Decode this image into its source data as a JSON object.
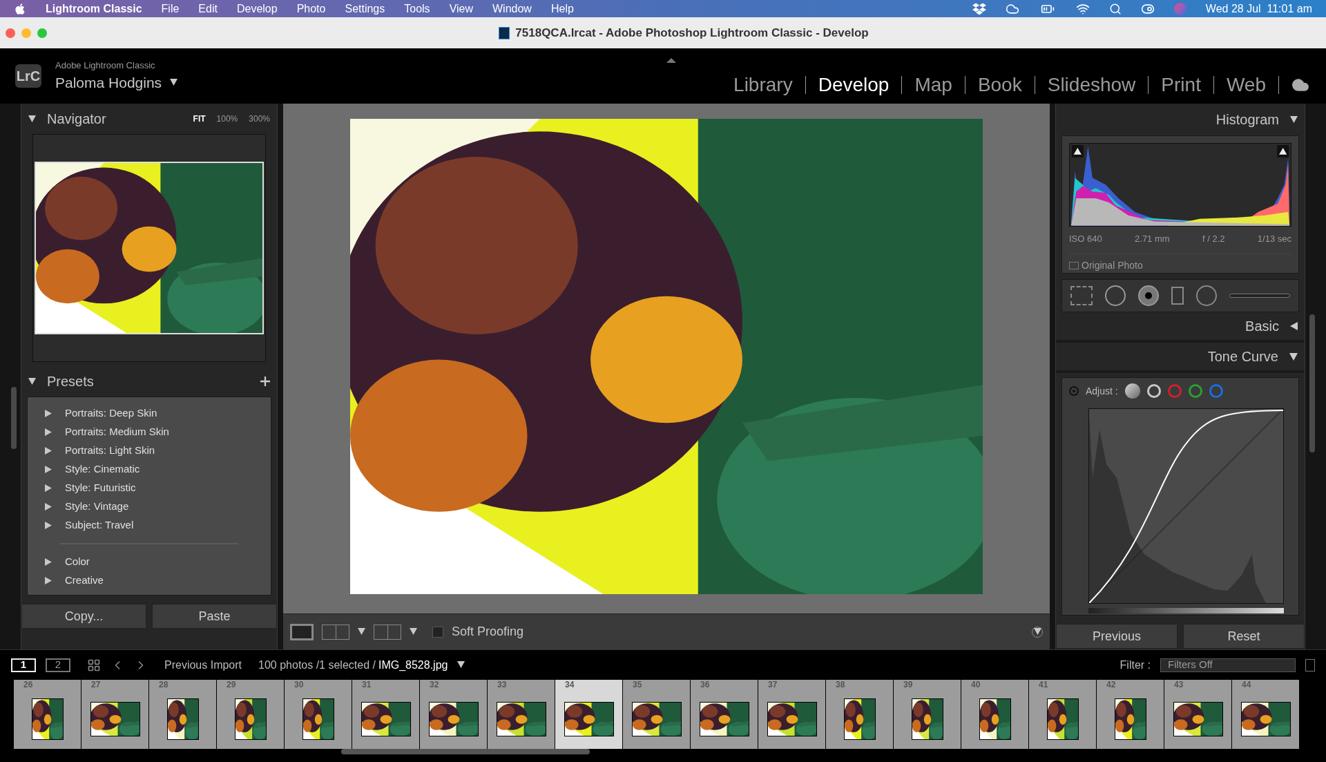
{
  "menubar": {
    "app": "Lightroom Classic",
    "menus": [
      "File",
      "Edit",
      "Develop",
      "Photo",
      "Settings",
      "Tools",
      "View",
      "Window",
      "Help"
    ],
    "clock": "Wed 28 Jul  11:01 am"
  },
  "window": {
    "title": "7518QCA.lrcat - Adobe Photoshop Lightroom Classic - Develop"
  },
  "identity": {
    "logo": "LrC",
    "product": "Adobe Lightroom Classic",
    "user": "Paloma Hodgins"
  },
  "modules": [
    {
      "label": "Library",
      "selected": false
    },
    {
      "label": "Develop",
      "selected": true
    },
    {
      "label": "Map",
      "selected": false
    },
    {
      "label": "Book",
      "selected": false
    },
    {
      "label": "Slideshow",
      "selected": false
    },
    {
      "label": "Print",
      "selected": false
    },
    {
      "label": "Web",
      "selected": false
    }
  ],
  "navigator": {
    "title": "Navigator",
    "zoom": [
      {
        "label": "FIT",
        "selected": true
      },
      {
        "label": "100%",
        "selected": false
      },
      {
        "label": "300%",
        "selected": false
      }
    ]
  },
  "presets": {
    "title": "Presets",
    "groups": [
      "Portraits: Deep Skin",
      "Portraits: Medium Skin",
      "Portraits: Light Skin",
      "Style: Cinematic",
      "Style: Futuristic",
      "Style: Vintage",
      "Subject: Travel"
    ],
    "more_groups": [
      "Color",
      "Creative"
    ]
  },
  "left_buttons": [
    "Copy...",
    "Paste"
  ],
  "toolbar": {
    "soft_proofing": {
      "label": "Soft Proofing",
      "checked": false
    }
  },
  "histogram": {
    "title": "Histogram",
    "exif": [
      "ISO 640",
      "2.71 mm",
      "f / 2.2",
      "1/13 sec"
    ],
    "original_photo": {
      "label": "Original Photo",
      "checked": false
    }
  },
  "panels": [
    {
      "title": "Basic",
      "expanded": false
    },
    {
      "title": "Tone Curve",
      "expanded": true
    }
  ],
  "tone_curve": {
    "adjust_label": "Adjust :",
    "channels": [
      {
        "color": "#c8c8c8"
      },
      {
        "color": "#d0202a"
      },
      {
        "color": "#2aa030"
      },
      {
        "color": "#1a6ee0"
      }
    ]
  },
  "right_buttons": [
    "Previous",
    "Reset"
  ],
  "filmstrip_bar": {
    "pages": [
      {
        "label": "1",
        "selected": true
      },
      {
        "label": "2",
        "selected": false
      }
    ],
    "source": "Previous Import",
    "count": "100 photos /1 selected /",
    "file": "IMG_8528.jpg",
    "filter_label": "Filter :",
    "filter_value": "Filters Off"
  },
  "filmstrip": [
    {
      "number": "26",
      "selected": false
    },
    {
      "number": "27",
      "selected": false
    },
    {
      "number": "28",
      "selected": false
    },
    {
      "number": "29",
      "selected": false
    },
    {
      "number": "30",
      "selected": false
    },
    {
      "number": "31",
      "selected": false
    },
    {
      "number": "32",
      "selected": false
    },
    {
      "number": "33",
      "selected": false
    },
    {
      "number": "34",
      "selected": true
    },
    {
      "number": "35",
      "selected": false
    },
    {
      "number": "36",
      "selected": false
    },
    {
      "number": "37",
      "selected": false
    },
    {
      "number": "38",
      "selected": false
    },
    {
      "number": "39",
      "selected": false
    },
    {
      "number": "40",
      "selected": false
    },
    {
      "number": "41",
      "selected": false
    },
    {
      "number": "42",
      "selected": false
    },
    {
      "number": "43",
      "selected": false
    },
    {
      "number": "44",
      "selected": false
    }
  ]
}
